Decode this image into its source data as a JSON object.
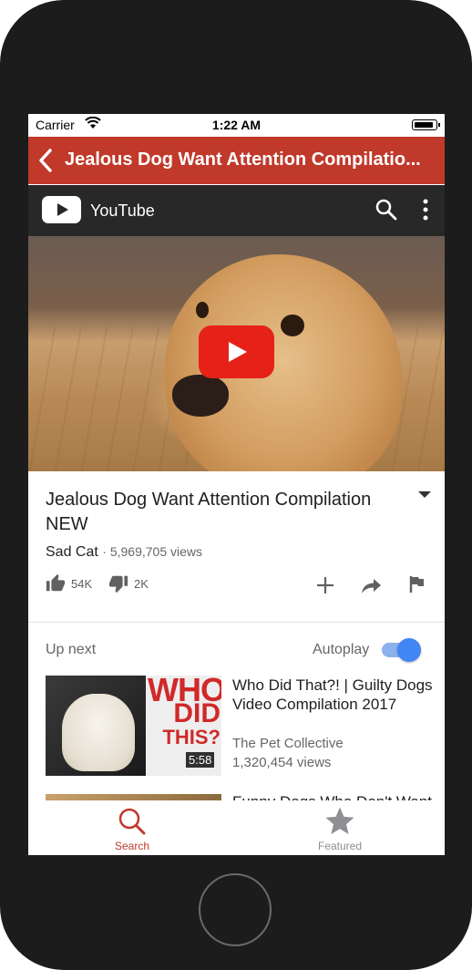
{
  "status_bar": {
    "carrier": "Carrier",
    "time": "1:22 AM"
  },
  "nav": {
    "title": "Jealous Dog Want Attention Compilatio..."
  },
  "youtube_bar": {
    "app_name": "YouTube",
    "icons": [
      "youtube-logo",
      "search-icon",
      "more-vert-icon"
    ]
  },
  "video": {
    "title": "Jealous Dog Want Attention Compilation NEW",
    "channel": "Sad Cat",
    "separator": "·",
    "views": "5,969,705 views"
  },
  "actions": {
    "likes": "54K",
    "dislikes": "2K"
  },
  "up_next": {
    "label": "Up next",
    "autoplay_label": "Autoplay",
    "autoplay_on": true,
    "items": [
      {
        "title": "Who Did That?! | Guilty Dogs Video Compilation 2017",
        "channel": "The Pet Collective",
        "views": "1,320,454 views",
        "duration": "5:58",
        "thumb_text": [
          "WHO",
          "DID",
          "THIS?"
        ]
      },
      {
        "title": "Funny Dogs Who Don't Want"
      }
    ]
  },
  "tabs": [
    {
      "label": "Search",
      "active": true
    },
    {
      "label": "Featured",
      "active": false
    }
  ],
  "colors": {
    "nav": "#c0392b",
    "youtube_bar": "#282828",
    "play": "#e62117",
    "active_tab": "#c0392b",
    "inactive_tab": "#8e8e93",
    "toggle": "#4285f4"
  }
}
